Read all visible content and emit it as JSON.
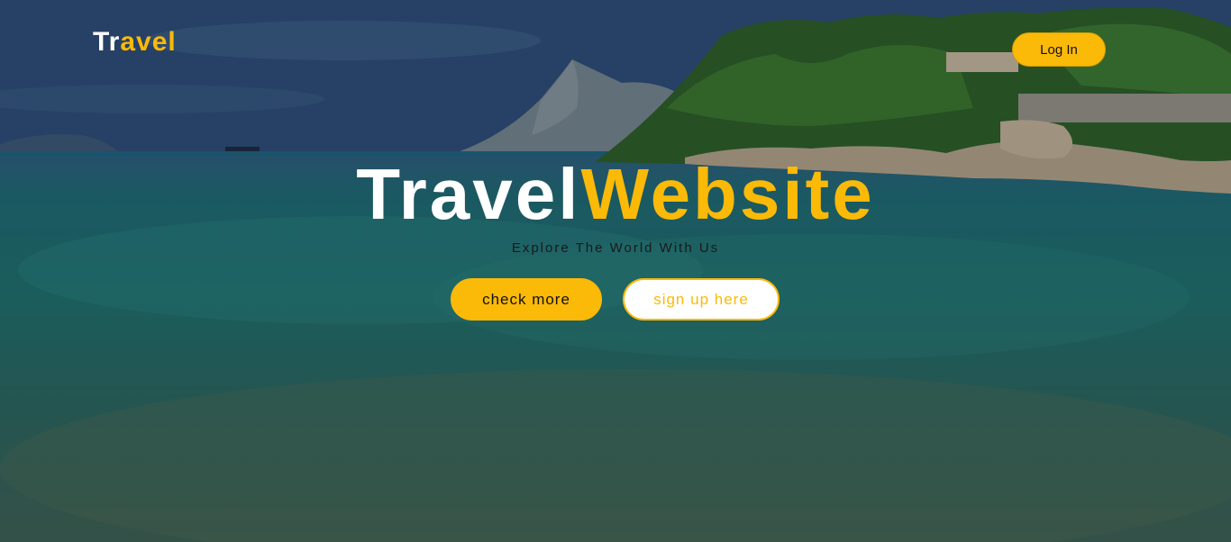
{
  "header": {
    "logo_part1": "Tr",
    "logo_part2": "avel",
    "login_label": "Log In"
  },
  "hero": {
    "title_part1": "Travel",
    "title_part2": "Website",
    "subtitle": "Explore The World With Us",
    "primary_button": "check more",
    "secondary_button": "sign up here"
  },
  "colors": {
    "accent": "#fbb908",
    "white": "#ffffff",
    "dark_text": "#111111"
  }
}
